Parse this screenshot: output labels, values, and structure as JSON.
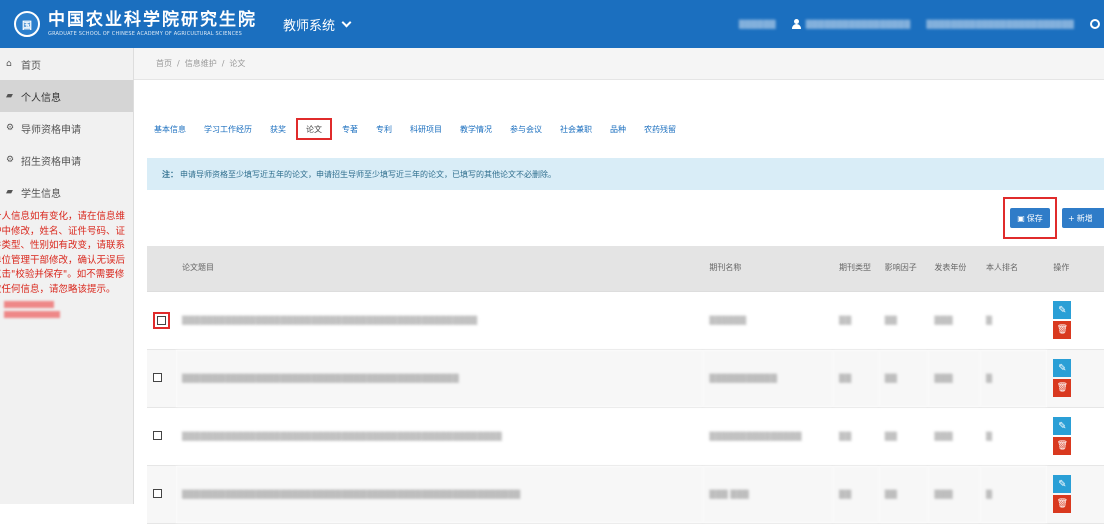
{
  "header": {
    "logo_text": "国",
    "brand_cn": "中国农业科学院研究生院",
    "brand_en": "GRADUATE SCHOOL OF CHINESE ACADEMY OF AGRICULTURAL SCIENCES",
    "system_name": "教师系统",
    "right_item_1": "▒▒▒▒▒▒",
    "user_name": "▒▒▒▒▒▒▒▒▒▒▒▒▒▒▒▒▒",
    "right_item_3": "▒▒▒▒▒▒▒▒▒▒▒▒▒▒▒▒▒▒▒▒▒▒▒▒"
  },
  "sidebar": {
    "items": [
      {
        "icon": "⌂",
        "label": "首页"
      },
      {
        "icon": "▰",
        "label": "个人信息"
      },
      {
        "icon": "⚙",
        "label": "导师资格申请"
      },
      {
        "icon": "⚙",
        "label": "招生资格申请"
      },
      {
        "icon": "▰",
        "label": "学生信息"
      }
    ],
    "note": "个人信息如有变化，请在信息维护中修改，姓名、证件号码、证件类型、性别如有改变，请联系单位管理干部修改，确认无误后点击\"校验并保存\"。如不需要修改任何信息，请忽略该提示。",
    "redacted_1": "▒▒▒▒▒▒▒▒",
    "redacted_2": "▒▒▒▒▒▒▒▒"
  },
  "breadcrumb": {
    "home": "首页",
    "sep": "/",
    "section": "信息维护",
    "current": "论文"
  },
  "tabs": [
    "基本信息",
    "学习工作经历",
    "获奖",
    "论文",
    "专著",
    "专利",
    "科研项目",
    "教学情况",
    "参与会议",
    "社会兼职",
    "品种",
    "农药残留"
  ],
  "active_tab_index": 3,
  "notice": {
    "prefix": "注：",
    "text": "申请导师资格至少填写近五年的论文，申请招生导师至少填写近三年的论文，已填写的其他论文不必删除。"
  },
  "buttons": {
    "save": "保存",
    "save_icon": "▣",
    "add": "新增",
    "add_icon": "+"
  },
  "table": {
    "headers": [
      "",
      "论文题目",
      "期刊名称",
      "期刊类型",
      "影响因子",
      "发表年份",
      "本人排名",
      "操作"
    ],
    "rows": [
      {
        "title": "▒▒▒▒▒▒▒▒▒▒▒▒▒▒▒▒▒▒▒▒▒▒▒▒▒▒▒▒▒▒▒▒▒▒▒▒▒▒▒▒▒▒▒▒▒▒▒▒",
        "journal": "▒▒▒▒▒▒",
        "type": "▒▒",
        "factor": "▒▒",
        "year": "▒▒▒",
        "rank": "▒"
      },
      {
        "title": "▒▒▒▒▒▒▒▒▒▒▒▒▒▒▒▒▒▒▒▒▒▒▒▒▒▒▒▒▒▒▒▒▒▒▒▒▒▒▒▒▒▒▒▒▒",
        "journal": "▒▒▒▒▒▒▒▒▒▒▒",
        "type": "▒▒",
        "factor": "▒▒",
        "year": "▒▒▒",
        "rank": "▒"
      },
      {
        "title": "▒▒▒▒▒▒▒▒▒▒▒▒▒▒▒▒▒▒▒▒▒▒▒▒▒▒▒▒▒▒▒▒▒▒▒▒▒▒▒▒▒▒▒▒▒▒▒▒▒▒▒▒",
        "journal": "▒▒▒▒▒▒▒▒▒▒▒▒▒▒▒",
        "type": "▒▒",
        "factor": "▒▒",
        "year": "▒▒▒",
        "rank": "▒"
      },
      {
        "title": "▒▒▒▒▒▒▒▒▒▒▒▒▒▒▒▒▒▒▒▒▒▒▒▒▒▒▒▒▒▒▒▒▒▒▒▒▒▒▒▒▒▒▒▒▒▒▒▒▒▒▒▒▒▒▒",
        "journal": "▒▒▒ ▒▒▒",
        "type": "▒▒",
        "factor": "▒▒",
        "year": "▒▒▒",
        "rank": "▒"
      }
    ],
    "edit_icon": "✎",
    "delete_icon": "🗑"
  },
  "colors": {
    "header": "#1b6fbf",
    "accent": "#2f7cc8",
    "highlight": "#e02b2b",
    "notice_bg": "#d9edf7",
    "sidebar_note": "#d9261c"
  }
}
